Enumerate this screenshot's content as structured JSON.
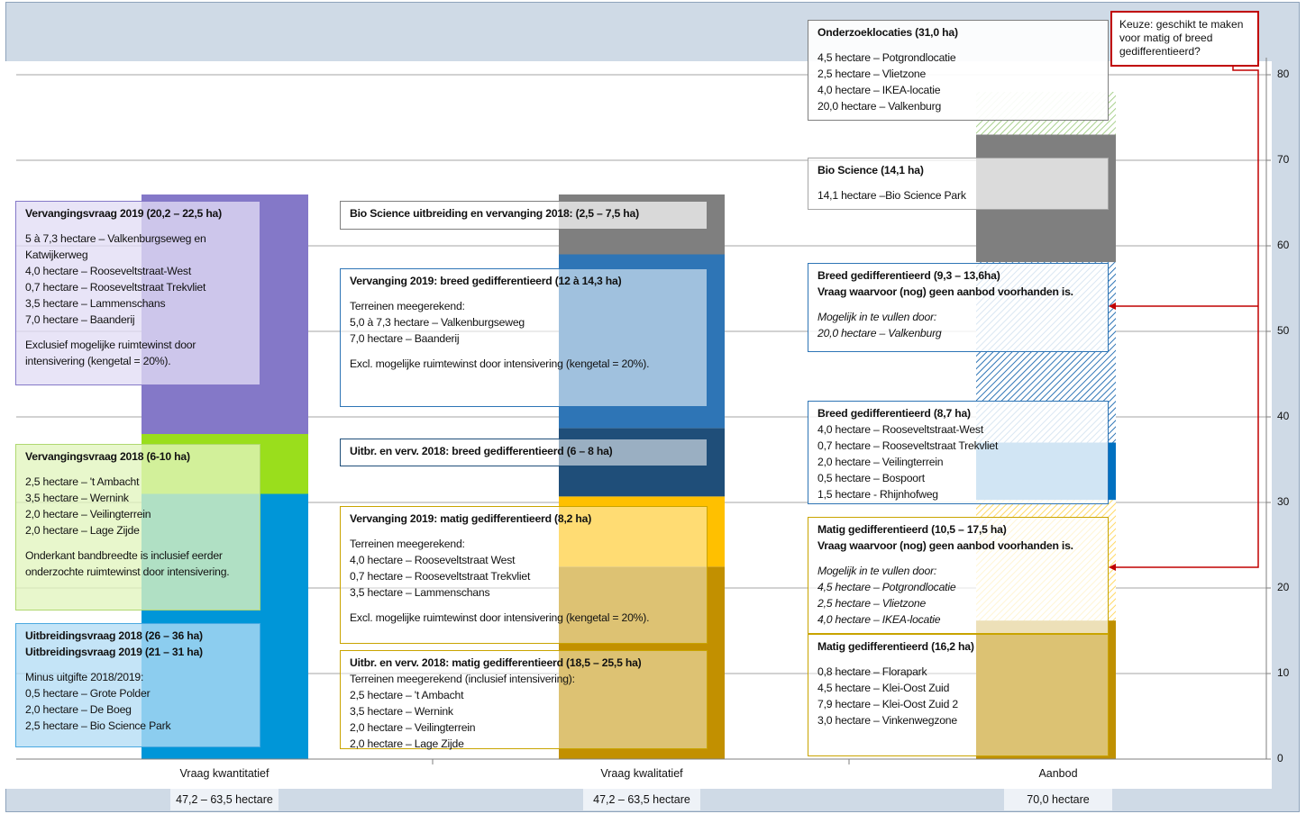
{
  "chart_data": {
    "type": "bar",
    "stacked": true,
    "categories": [
      "Vraag kwantitatief",
      "Vraag kwalitatief",
      "Aanbod"
    ],
    "totals": [
      "47,2 – 63,5 hectare",
      "47,2 – 63,5 hectare",
      "70,0 hectare"
    ],
    "ylim": [
      0,
      80
    ],
    "yticks": [
      0,
      10,
      20,
      30,
      40,
      50,
      60,
      70,
      80
    ],
    "grid": true,
    "segments": [
      {
        "cat": 0,
        "y0": 0,
        "y1": 31,
        "color": "#0096d8"
      },
      {
        "cat": 0,
        "y0": 31,
        "y1": 38,
        "color": "#9ade1c"
      },
      {
        "cat": 0,
        "y0": 38,
        "y1": 66,
        "color": "#8478c8"
      },
      {
        "cat": 1,
        "y0": 0,
        "y1": 22.5,
        "color": "#c29000"
      },
      {
        "cat": 1,
        "y0": 22.5,
        "y1": 30.7,
        "color": "#ffc000"
      },
      {
        "cat": 1,
        "y0": 30.7,
        "y1": 38.7,
        "color": "#1f4e79"
      },
      {
        "cat": 1,
        "y0": 38.7,
        "y1": 59,
        "color": "#2e75b6"
      },
      {
        "cat": 1,
        "y0": 59,
        "y1": 66,
        "color": "#7f7f7f"
      },
      {
        "cat": 2,
        "y0": 0,
        "y1": 16.2,
        "color": "#bf9000"
      },
      {
        "cat": 2,
        "y0": 16.2,
        "y1": 30.3,
        "color": "#ffd966",
        "pattern": true
      },
      {
        "cat": 2,
        "y0": 30.3,
        "y1": 37,
        "color": "#0070c0"
      },
      {
        "cat": 2,
        "y0": 37,
        "y1": 58.1,
        "color": "#2e75b6",
        "pattern": true
      },
      {
        "cat": 2,
        "y0": 58.1,
        "y1": 73,
        "color": "#7f7f7f"
      },
      {
        "cat": 2,
        "y0": 73,
        "y1": 78,
        "color": "#a9d18e",
        "pattern": true
      }
    ]
  },
  "note": "Keuze: geschikt te maken voor matig of breed gedifferentieerd?",
  "boxes": [
    {
      "title": [
        "Vervangingsvraag 2019 (20,2 – 22,5 ha)"
      ],
      "lines": [
        "",
        "5 à 7,3 hectare – Valkenburgseweg en",
        "Katwijkerweg",
        "4,0 hectare – Rooseveltstraat-West",
        "0,7 hectare – Rooseveltstraat Trekvliet",
        "3,5 hectare – Lammenschans",
        "7,0 hectare – Baanderij",
        "",
        "Exclusief mogelijke ruimtewinst door",
        "intensivering (kengetal = 20%)."
      ]
    },
    {
      "title": [
        "Vervangingsvraag 2018 (6-10 ha)"
      ],
      "lines": [
        "",
        "2,5 hectare – 't Ambacht",
        "3,5 hectare – Wernink",
        "2,0 hectare – Veilingterrein",
        "2,0 hectare – Lage Zijde",
        "",
        "Onderkant bandbreedte is inclusief eerder",
        "onderzochte ruimtewinst door intensivering."
      ]
    },
    {
      "title": [
        "Uitbreidingsvraag 2018 (26 – 36 ha)",
        "Uitbreidingsvraag 2019 (21 – 31 ha)"
      ],
      "lines": [
        "",
        "Minus uitgifte 2018/2019:",
        "0,5 hectare – Grote Polder",
        "2,0 hectare – De Boeg",
        "2,5 hectare – Bio Science Park"
      ]
    },
    {
      "title": [
        "Bio Science uitbreiding en vervanging 2018: (2,5 – 7,5 ha)"
      ],
      "lines": []
    },
    {
      "title": [
        "Vervanging 2019: breed gedifferentieerd (12 à 14,3 ha)"
      ],
      "lines": [
        "",
        "Terreinen meegerekend:",
        "5,0 à  7,3 hectare – Valkenburgseweg",
        "7,0 hectare – Baanderij",
        "",
        "Excl. mogelijke ruimtewinst door intensivering (kengetal = 20%)."
      ]
    },
    {
      "title": [
        "Uitbr. en verv. 2018: breed gedifferentieerd (6 – 8 ha)"
      ],
      "lines": []
    },
    {
      "title": [
        "Vervanging 2019: matig gedifferentieerd (8,2 ha)"
      ],
      "lines": [
        "",
        "Terreinen meegerekend:",
        "4,0 hectare – Rooseveltstraat West",
        "0,7 hectare – Rooseveltstraat Trekvliet",
        "3,5 hectare – Lammenschans",
        "",
        "Excl. mogelijke ruimtewinst door intensivering (kengetal = 20%)."
      ]
    },
    {
      "title": [
        "Uitbr. en verv. 2018: matig gedifferentieerd (18,5 – 25,5 ha)"
      ],
      "lines": [
        "Terreinen meegerekend (inclusief intensivering):",
        "2,5 hectare – 't Ambacht",
        "3,5 hectare – Wernink",
        "2,0 hectare – Veilingterrein",
        "2,0 hectare – Lage Zijde"
      ]
    },
    {
      "title": [
        "Onderzoeklocaties (31,0 ha)"
      ],
      "lines": [
        "",
        "4,5 hectare – Potgrondlocatie",
        "2,5 hectare – Vlietzone",
        "4,0 hectare – IKEA-locatie",
        "20,0 hectare – Valkenburg"
      ]
    },
    {
      "title": [
        "Bio Science (14,1 ha)"
      ],
      "lines": [
        "",
        "14,1 hectare –Bio Science Park"
      ]
    },
    {
      "title": [
        "Breed gedifferentieerd (9,3 – 13,6ha)",
        "Vraag waarvoor (nog) geen aanbod voorhanden is."
      ],
      "lines": [
        "",
        "Mogelijk in te vullen door:",
        "20,0 hectare – Valkenburg"
      ],
      "italic": true
    },
    {
      "title": [
        "Breed gedifferentieerd (8,7 ha)"
      ],
      "lines": [
        "4,0 hectare – Rooseveltstraat-West",
        "0,7 hectare – Rooseveltstraat Trekvliet",
        "2,0 hectare – Veilingterrein",
        "0,5 hectare – Bospoort",
        "1,5 hectare - Rhijnhofweg"
      ]
    },
    {
      "title": [
        "Matig gedifferentieerd (10,5 – 17,5 ha)",
        "Vraag waarvoor (nog) geen aanbod voorhanden is."
      ],
      "lines": [
        "",
        "Mogelijk in te vullen door:",
        "4,5 hectare – Potgrondlocatie",
        "2,5 hectare – Vlietzone",
        "4,0 hectare – IKEA-locatie"
      ],
      "italic": true
    },
    {
      "title": [
        "Matig gedifferentieerd (16,2 ha)"
      ],
      "lines": [
        "",
        "0,8 hectare – Florapark",
        "4,5 hectare – Klei-Oost Zuid",
        "7,9 hectare – Klei-Oost Zuid 2",
        "3,0 hectare – Vinkenwegzone"
      ]
    }
  ]
}
